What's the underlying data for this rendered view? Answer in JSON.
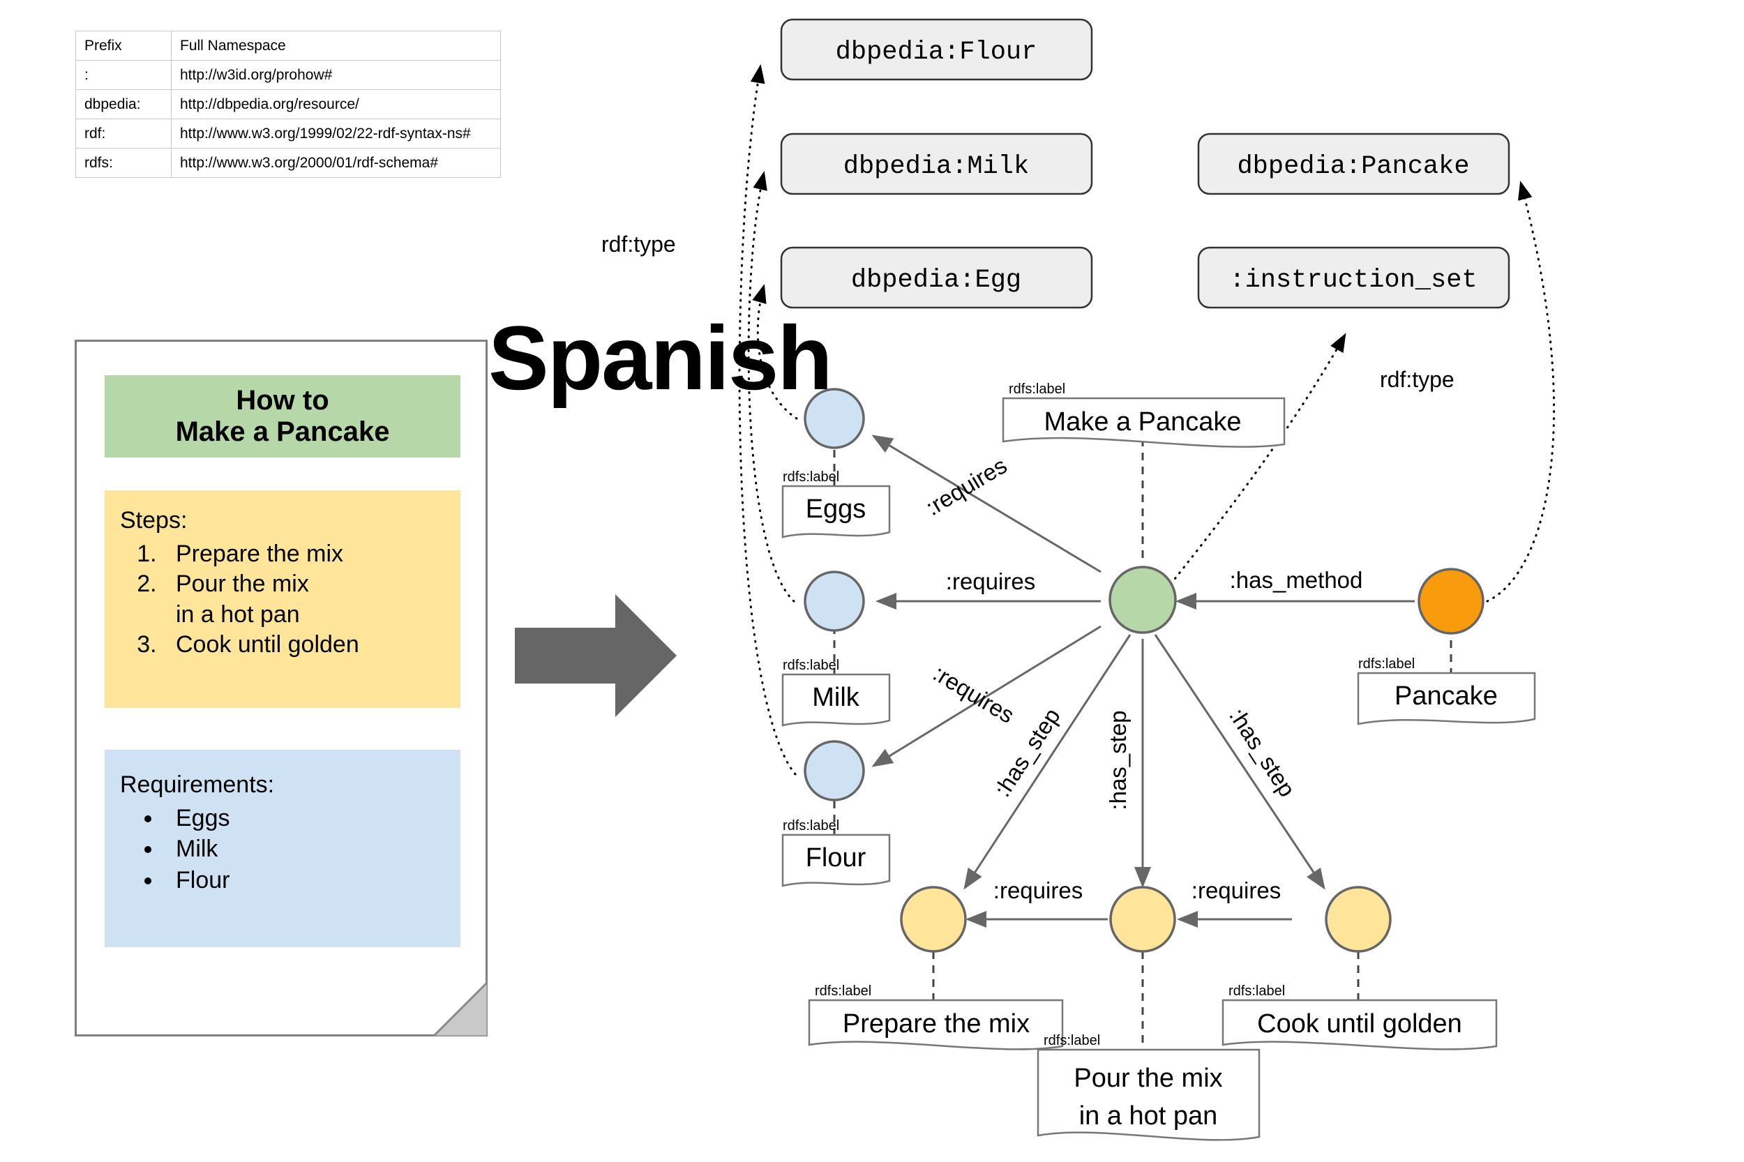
{
  "prefix_table": {
    "headers": [
      "Prefix",
      "Full Namespace"
    ],
    "rows": [
      {
        "prefix": ":",
        "namespace": "http://w3id.org/prohow#"
      },
      {
        "prefix": "dbpedia:",
        "namespace": "http://dbpedia.org/resource/"
      },
      {
        "prefix": "rdf:",
        "namespace": "http://www.w3.org/1999/02/22-rdf-syntax-ns#"
      },
      {
        "prefix": "rdfs:",
        "namespace": "http://www.w3.org/2000/01/rdf-schema#"
      }
    ]
  },
  "document_card": {
    "title_line1": "How to",
    "title_line2": "Make a Pancake",
    "steps_heading": "Steps:",
    "steps": [
      "Prepare the mix",
      "Pour the mix\nin a hot pan",
      "Cook until golden"
    ],
    "steps_display": [
      "Prepare the mix",
      "Pour the mix",
      "in a hot pan",
      "Cook until golden"
    ],
    "requirements_heading": "Requirements:",
    "requirements": [
      "Eggs",
      "Milk",
      "Flour"
    ],
    "title_bg": "#b6d7a8",
    "steps_bg": "#ffe599",
    "requirements_bg": "#cfe2f3"
  },
  "overlay": {
    "word": "Spanish"
  },
  "transform_arrow": {
    "direction": "right",
    "color": "#666666"
  },
  "graph": {
    "class_boxes": [
      {
        "id": "cls-flour",
        "label": "dbpedia:Flour"
      },
      {
        "id": "cls-milk",
        "label": "dbpedia:Milk"
      },
      {
        "id": "cls-egg",
        "label": "dbpedia:Egg"
      },
      {
        "id": "cls-pancake",
        "label": "dbpedia:Pancake"
      },
      {
        "id": "cls-instruction-set",
        "label": ":instruction_set"
      }
    ],
    "nodes": [
      {
        "id": "node-eggs",
        "color": "#cfe2f3",
        "label": "Eggs",
        "label_tag": "rdfs:label"
      },
      {
        "id": "node-milk",
        "color": "#cfe2f3",
        "label": "Milk",
        "label_tag": "rdfs:label"
      },
      {
        "id": "node-flour",
        "color": "#cfe2f3",
        "label": "Flour",
        "label_tag": "rdfs:label"
      },
      {
        "id": "node-main",
        "color": "#b6d7a8",
        "label": "Make a Pancake",
        "label_tag": "rdfs:label"
      },
      {
        "id": "node-pancake",
        "color": "#f89c0e",
        "label": "Pancake",
        "label_tag": "rdfs:label"
      },
      {
        "id": "node-step1",
        "color": "#ffe599",
        "label": "Prepare the mix",
        "label_tag": "rdfs:label"
      },
      {
        "id": "node-step2",
        "color": "#ffe599",
        "label_line1": "Pour the mix",
        "label_line2": "in a hot pan",
        "label_tag": "rdfs:label"
      },
      {
        "id": "node-step3",
        "color": "#ffe599",
        "label": "Cook until golden",
        "label_tag": "rdfs:label"
      }
    ],
    "edge_labels": {
      "requires": ":requires",
      "has_step": ":has_step",
      "has_method": ":has_method",
      "rdf_type": "rdf:type",
      "rdfs_label": "rdfs:label"
    },
    "edges": [
      {
        "from": "node-main",
        "to": "node-eggs",
        "label": ":requires"
      },
      {
        "from": "node-main",
        "to": "node-milk",
        "label": ":requires"
      },
      {
        "from": "node-main",
        "to": "node-flour",
        "label": ":requires"
      },
      {
        "from": "node-main",
        "to": "node-step1",
        "label": ":has_step"
      },
      {
        "from": "node-main",
        "to": "node-step2",
        "label": ":has_step"
      },
      {
        "from": "node-main",
        "to": "node-step3",
        "label": ":has_step"
      },
      {
        "from": "node-pancake",
        "to": "node-main",
        "label": ":has_method"
      },
      {
        "from": "node-step2",
        "to": "node-step1",
        "label": ":requires"
      },
      {
        "from": "node-step3",
        "to": "node-step2",
        "label": ":requires"
      },
      {
        "from": "node-eggs",
        "to": "cls-egg",
        "label": "rdf:type",
        "style": "dotted"
      },
      {
        "from": "node-milk",
        "to": "cls-milk",
        "label": "rdf:type",
        "style": "dotted"
      },
      {
        "from": "node-flour",
        "to": "cls-flour",
        "label": "rdf:type",
        "style": "dotted"
      },
      {
        "from": "node-main",
        "to": "cls-instruction-set",
        "label": "rdf:type",
        "style": "dotted"
      },
      {
        "from": "node-pancake",
        "to": "cls-pancake",
        "label": "rdf:type",
        "style": "dotted"
      }
    ],
    "type_label_left": "rdf:type",
    "type_label_right": "rdf:type"
  }
}
